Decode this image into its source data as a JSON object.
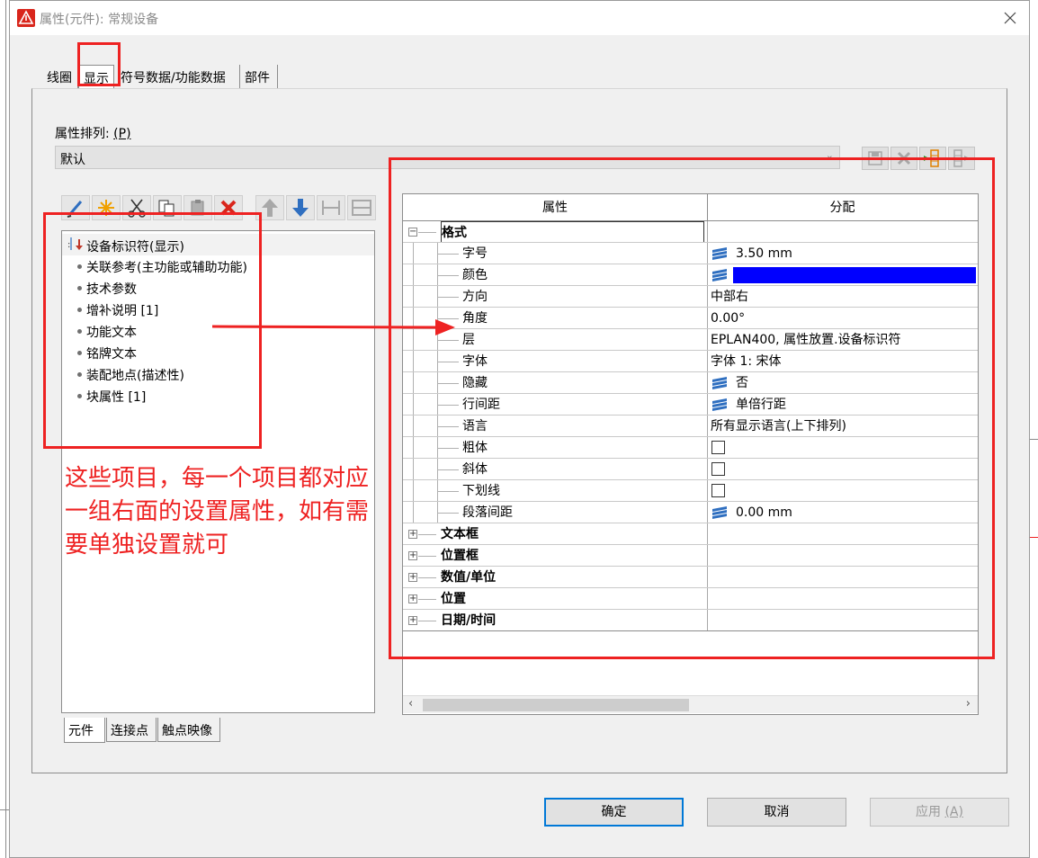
{
  "window": {
    "title": "属性(元件): 常规设备",
    "close_glyph": "✕"
  },
  "tabs": [
    {
      "label": "线圈"
    },
    {
      "label": "显示"
    },
    {
      "label": "符号数据/功能数据"
    },
    {
      "label": "部件"
    }
  ],
  "property_order": {
    "label": "属性排列:",
    "hotkey": "(P)",
    "value": "默认"
  },
  "left_list": {
    "items": [
      {
        "label": "设备标识符(显示)"
      },
      {
        "label": "关联参考(主功能或辅助功能)"
      },
      {
        "label": "技术参数"
      },
      {
        "label": "增补说明 [1]"
      },
      {
        "label": "功能文本"
      },
      {
        "label": "铭牌文本"
      },
      {
        "label": "装配地点(描述性)"
      },
      {
        "label": "块属性 [1]"
      }
    ]
  },
  "bottom_tabs": [
    {
      "label": "元件"
    },
    {
      "label": "连接点"
    },
    {
      "label": "触点映像"
    }
  ],
  "grid": {
    "columns": {
      "property": "属性",
      "value": "分配"
    },
    "group_format": "格式",
    "rows": [
      {
        "name": "字号",
        "value": "3.50 mm"
      },
      {
        "name": "颜色",
        "value": ""
      },
      {
        "name": "方向",
        "value": "中部右"
      },
      {
        "name": "角度",
        "value": "0.00°"
      },
      {
        "name": "层",
        "value": "EPLAN400, 属性放置.设备标识符"
      },
      {
        "name": "字体",
        "value": "字体 1: 宋体"
      },
      {
        "name": "隐藏",
        "value": "否"
      },
      {
        "name": "行间距",
        "value": "单倍行距"
      },
      {
        "name": "语言",
        "value": "所有显示语言(上下排列)"
      },
      {
        "name": "粗体",
        "value": ""
      },
      {
        "name": "斜体",
        "value": ""
      },
      {
        "name": "下划线",
        "value": ""
      },
      {
        "name": "段落间距",
        "value": "0.00 mm"
      }
    ],
    "collapsed_groups": [
      {
        "name": "文本框"
      },
      {
        "name": "位置框"
      },
      {
        "name": "数值/单位"
      },
      {
        "name": "位置"
      },
      {
        "name": "日期/时间"
      }
    ],
    "color_value": "#0000ff"
  },
  "buttons": {
    "ok": "确定",
    "cancel": "取消",
    "apply": "应用",
    "apply_hotkey": "(A)"
  },
  "annotation": {
    "text": "这些项目，每一个项目都对应一组右面的设置属性，如有需要单独设置就可",
    "color": "#ee2222"
  }
}
